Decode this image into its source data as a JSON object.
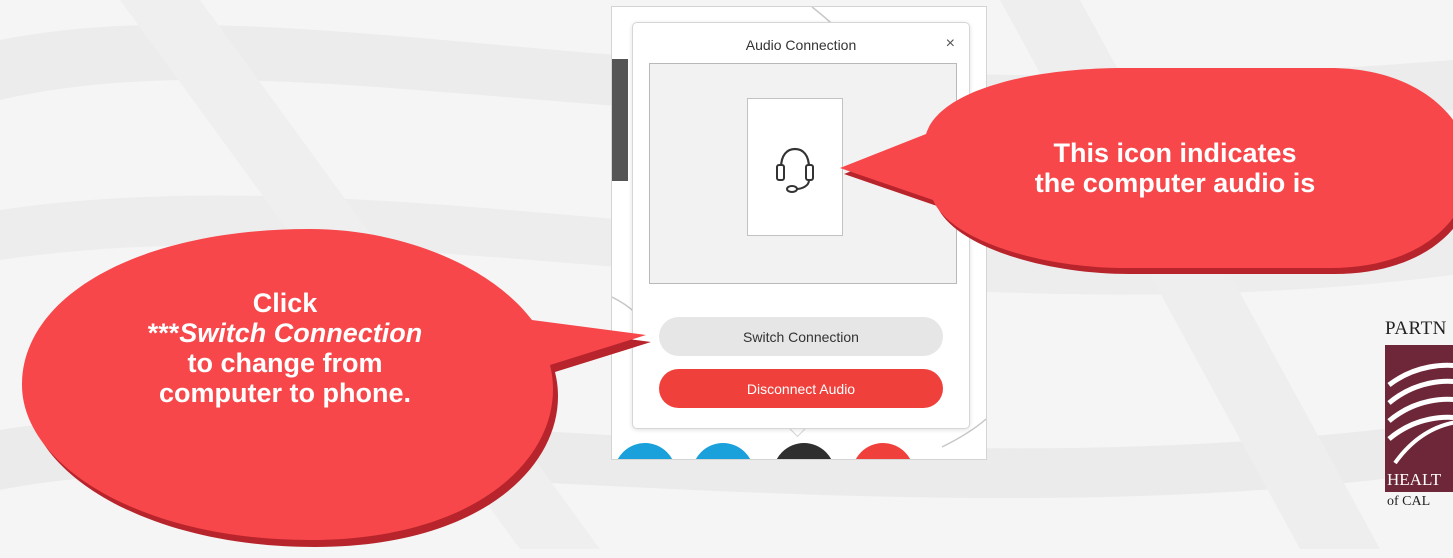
{
  "popup": {
    "title": "Audio Connection",
    "close_glyph": "×",
    "device_icon": "headset-icon",
    "switch_label": "Switch Connection",
    "disconnect_label": "Disconnect Audio"
  },
  "callouts": {
    "right": {
      "line1": "This icon indicates",
      "line2": "the computer audio is"
    },
    "left": {
      "line1": "Click",
      "line2_prefix": "***",
      "line2_emph": "Switch Connection",
      "line3": "to change from",
      "line4": "computer to phone."
    }
  },
  "logo": {
    "top_text": "PARTN",
    "bottom_text": "HEALT",
    "sub_text": "of CAL"
  },
  "colors": {
    "callout_red": "#f7474a",
    "disconnect_red": "#f0403b",
    "switch_gray": "#e6e6e6",
    "logo_maroon": "#6e2738",
    "control_blue": "#1aa1db",
    "control_dark": "#2f2f2f"
  }
}
